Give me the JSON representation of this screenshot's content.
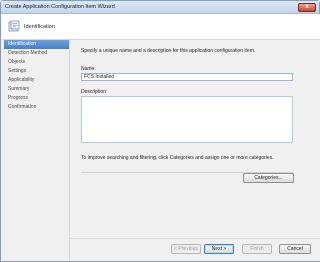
{
  "window": {
    "title": "Create Application Configuration Item Wizard",
    "close_glyph": "x"
  },
  "header": {
    "title": "Identification",
    "icon": "wizard-page-icon"
  },
  "nav": {
    "items": [
      {
        "label": "Identification",
        "active": true
      },
      {
        "label": "Detection Method",
        "active": false
      },
      {
        "label": "Objects",
        "active": false
      },
      {
        "label": "Settings",
        "active": false
      },
      {
        "label": "Applicability",
        "active": false
      },
      {
        "label": "Summary",
        "active": false
      },
      {
        "label": "Progress",
        "active": false
      },
      {
        "label": "Confirmation",
        "active": false
      }
    ]
  },
  "main": {
    "instruction": "Specify a unique name and a description for this application configuration item.",
    "name_label": "Name:",
    "name_value": "FCS Installed",
    "description_label": "Description:",
    "description_value": "",
    "hint": "To improve searching and filtering, click Categories and assign one or more categories.",
    "categories_button": "Categories..."
  },
  "footer": {
    "previous": "< Previous",
    "next": "Next >",
    "finish": "Finish",
    "cancel": "Cancel"
  }
}
